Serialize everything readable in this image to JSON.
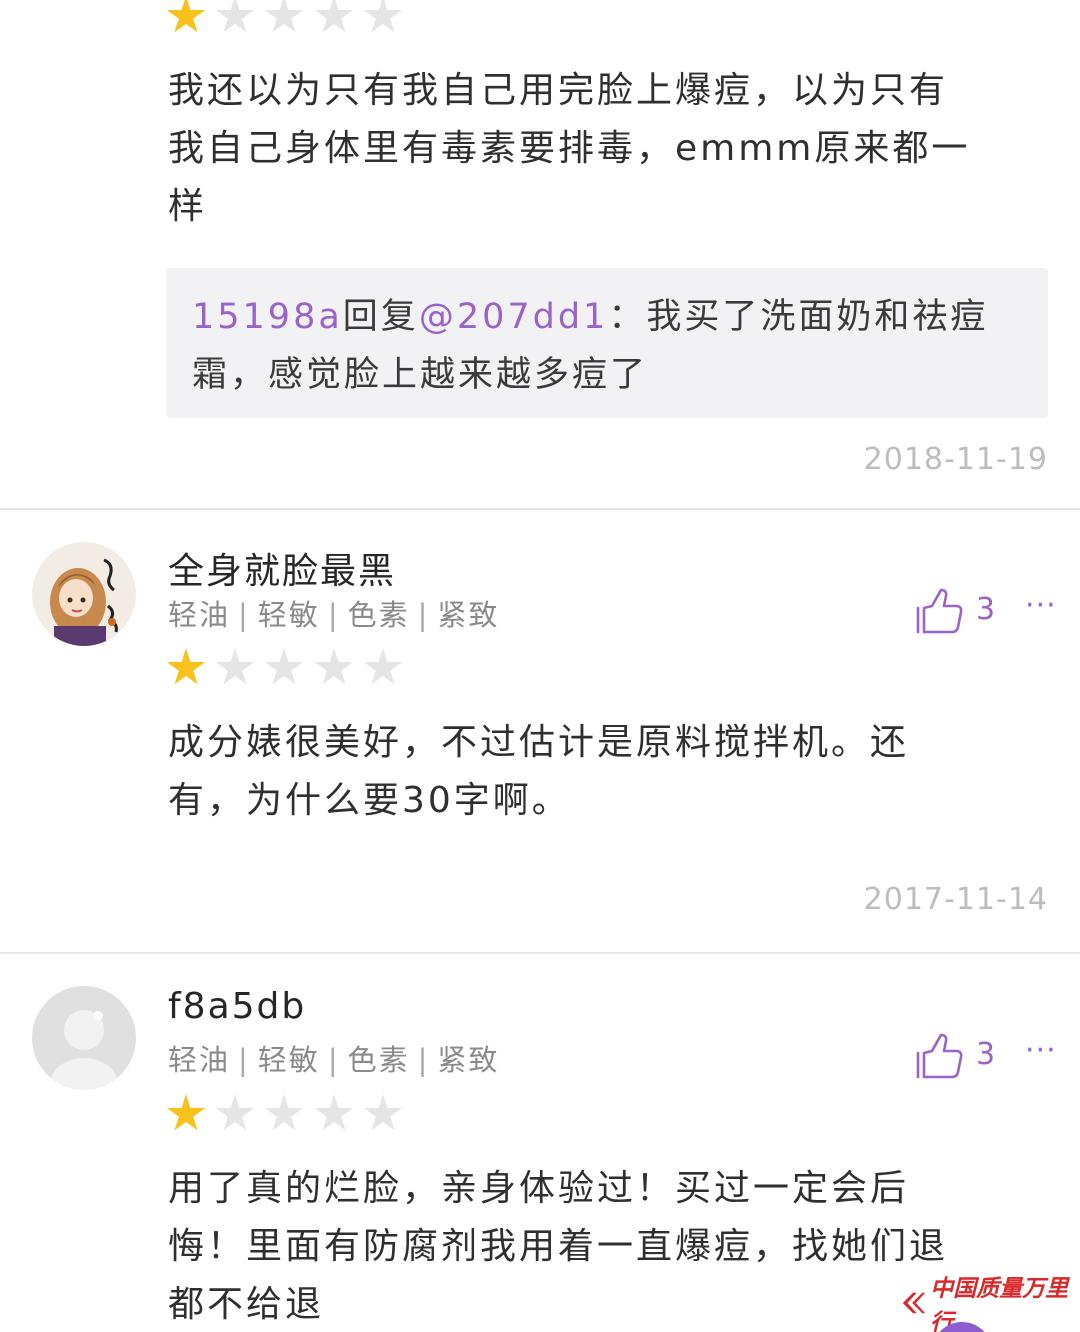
{
  "review0": {
    "rating": 1,
    "text": "我还以为只有我自己用完脸上爆痘，以为只有\n我自己身体里有毒素要排毒，emmm原来都一\n样",
    "reply": {
      "user": "15198a",
      "connector": "回复",
      "target": "@207dd1",
      "text": "：我买了洗面奶和祛痘\n霜，感觉脸上越来越多痘了"
    },
    "date": "2018-11-19"
  },
  "review1": {
    "username": "全身就脸最黑",
    "tags": [
      "轻油",
      "轻敏",
      "色素",
      "紧致"
    ],
    "likes": "3",
    "rating": 1,
    "text": "成分婊很美好，不过估计是原料搅拌机。还\n有，为什么要30字啊。",
    "date": "2017-11-14"
  },
  "review2": {
    "username": "f8a5db",
    "tags": [
      "轻油",
      "轻敏",
      "色素",
      "紧致"
    ],
    "likes": "3",
    "rating": 1,
    "text": "用了真的烂脸，亲身体验过！买过一定会后\n悔！里面有防腐剂我用着一直爆痘，找她们退\n都不给退"
  },
  "more_label": "···",
  "colors": {
    "accent": "#9a63c9",
    "star_on": "#f9c21b",
    "star_off": "#e5e5e5"
  },
  "watermark": {
    "text": "中国质量万里行"
  },
  "icons": {
    "like": "thumbs-up-icon",
    "more": "more-dots-icon",
    "star": "star-icon"
  }
}
